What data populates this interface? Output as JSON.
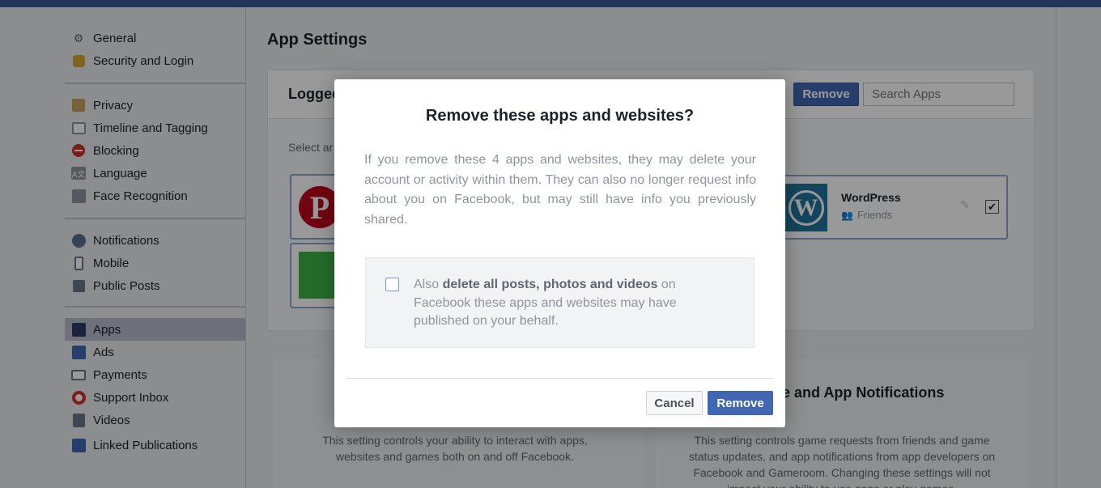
{
  "colors": {
    "brand": "#3b5998",
    "primary_button": "#4267b2",
    "active_nav": "#b7bccd"
  },
  "sidebar": {
    "groups": [
      [
        {
          "label": "General",
          "icon": "gears-icon"
        },
        {
          "label": "Security and Login",
          "icon": "shield-badge-icon"
        }
      ],
      [
        {
          "label": "Privacy",
          "icon": "lock-icon"
        },
        {
          "label": "Timeline and Tagging",
          "icon": "timeline-icon"
        },
        {
          "label": "Blocking",
          "icon": "block-icon"
        },
        {
          "label": "Language",
          "icon": "language-icon"
        },
        {
          "label": "Face Recognition",
          "icon": "face-icon"
        }
      ],
      [
        {
          "label": "Notifications",
          "icon": "globe-icon"
        },
        {
          "label": "Mobile",
          "icon": "mobile-icon"
        },
        {
          "label": "Public Posts",
          "icon": "rss-icon"
        }
      ],
      [
        {
          "label": "Apps",
          "icon": "apps-icon",
          "active": true
        },
        {
          "label": "Ads",
          "icon": "ads-icon"
        },
        {
          "label": "Payments",
          "icon": "card-icon"
        },
        {
          "label": "Support Inbox",
          "icon": "lifebuoy-icon"
        },
        {
          "label": "Videos",
          "icon": "film-icon"
        },
        {
          "label": "Linked Publications",
          "icon": "publication-icon"
        }
      ]
    ]
  },
  "main": {
    "title": "App Settings",
    "card": {
      "title": "Logged",
      "remove_label": "Remove",
      "search_placeholder": "Search Apps",
      "select_text": "Select ar",
      "app": {
        "name": "WordPress",
        "audience": "Friends"
      }
    },
    "lower": {
      "right_title": "ne and App Notifications",
      "left_text": "This setting controls your ability to interact with apps, websites and games both on and off Facebook.",
      "right_text": "This setting controls game requests from friends and game status updates, and app notifications from app developers on Facebook and Gameroom. Changing these settings will not impact your ability to use apps or play games."
    }
  },
  "modal": {
    "title": "Remove these apps and websites?",
    "body": "If you remove these 4 apps and websites, they may delete your account or activity within them. They can also no longer request info about you on Facebook, but may still have info you previously shared.",
    "check_prefix": "Also ",
    "check_bold": "delete all posts, photos and videos",
    "check_suffix": " on Facebook these apps and websites may have published on your behalf.",
    "cancel_label": "Cancel",
    "remove_label": "Remove"
  }
}
